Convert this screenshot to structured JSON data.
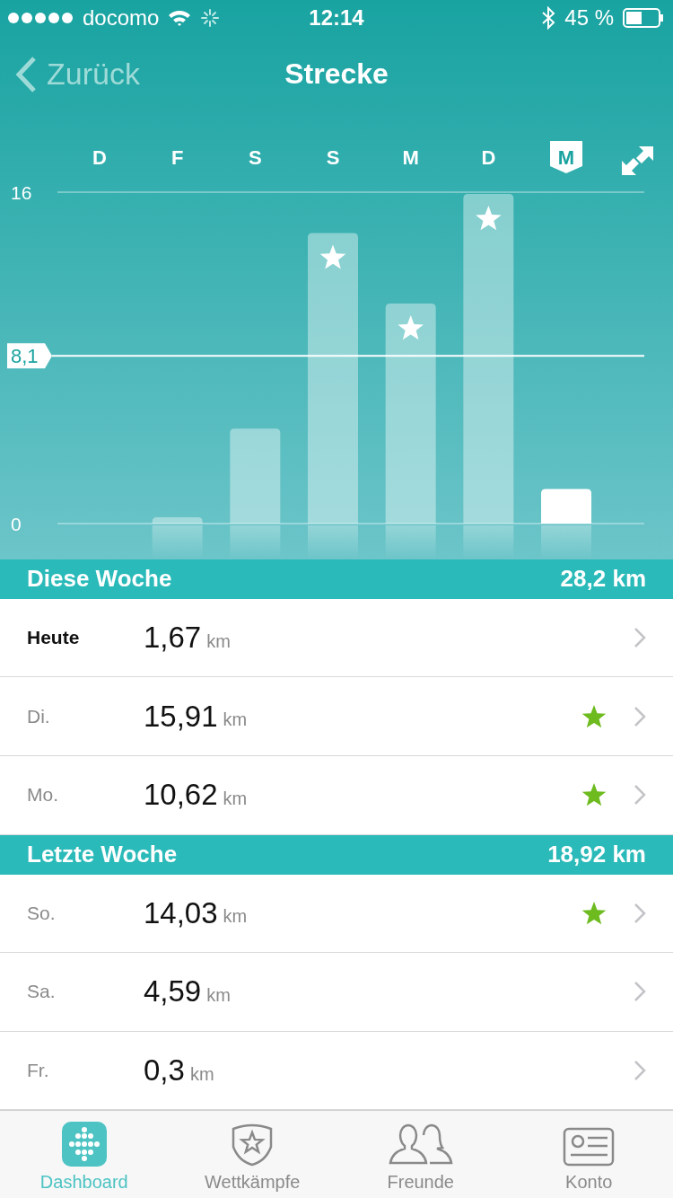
{
  "status_bar": {
    "carrier": "docomo",
    "time": "12:14",
    "battery": "45 %"
  },
  "nav": {
    "back": "Zurück",
    "title": "Strecke"
  },
  "chart": {
    "days": [
      {
        "label": "D",
        "selected": false,
        "goal_met": false
      },
      {
        "label": "F",
        "selected": false,
        "goal_met": false
      },
      {
        "label": "S",
        "selected": false,
        "goal_met": false
      },
      {
        "label": "S",
        "selected": false,
        "goal_met": true
      },
      {
        "label": "M",
        "selected": false,
        "goal_met": true
      },
      {
        "label": "D",
        "selected": false,
        "goal_met": true
      },
      {
        "label": "M",
        "selected": true,
        "goal_met": false
      }
    ],
    "chart_data": {
      "type": "bar",
      "values": [
        0,
        0.3,
        4.59,
        14.03,
        10.62,
        15.91,
        1.67
      ],
      "ylim": [
        0,
        16
      ],
      "yticks": [
        0,
        16
      ],
      "ref_lines": [
        {
          "axis": "y",
          "value": 8.1,
          "label": "8,1"
        }
      ]
    }
  },
  "sections": [
    {
      "title": "Diese Woche",
      "total": "28,2 km",
      "rows": [
        {
          "day": "Heute",
          "emphasis": true,
          "value": "1,67",
          "unit": "km",
          "goal_met": false
        },
        {
          "day": "Di.",
          "emphasis": false,
          "value": "15,91",
          "unit": "km",
          "goal_met": true
        },
        {
          "day": "Mo.",
          "emphasis": false,
          "value": "10,62",
          "unit": "km",
          "goal_met": true
        }
      ]
    },
    {
      "title": "Letzte Woche",
      "total": "18,92 km",
      "rows": [
        {
          "day": "So.",
          "emphasis": false,
          "value": "14,03",
          "unit": "km",
          "goal_met": true
        },
        {
          "day": "Sa.",
          "emphasis": false,
          "value": "4,59",
          "unit": "km",
          "goal_met": false
        },
        {
          "day": "Fr.",
          "emphasis": false,
          "value": "0,3",
          "unit": "km",
          "goal_met": false
        }
      ]
    }
  ],
  "tabs": [
    {
      "label": "Dashboard",
      "kind": "dashboard",
      "selected": true
    },
    {
      "label": "Wettkämpfe",
      "kind": "challenges",
      "selected": false
    },
    {
      "label": "Freunde",
      "kind": "friends",
      "selected": false
    },
    {
      "label": "Konto",
      "kind": "account",
      "selected": false
    }
  ]
}
